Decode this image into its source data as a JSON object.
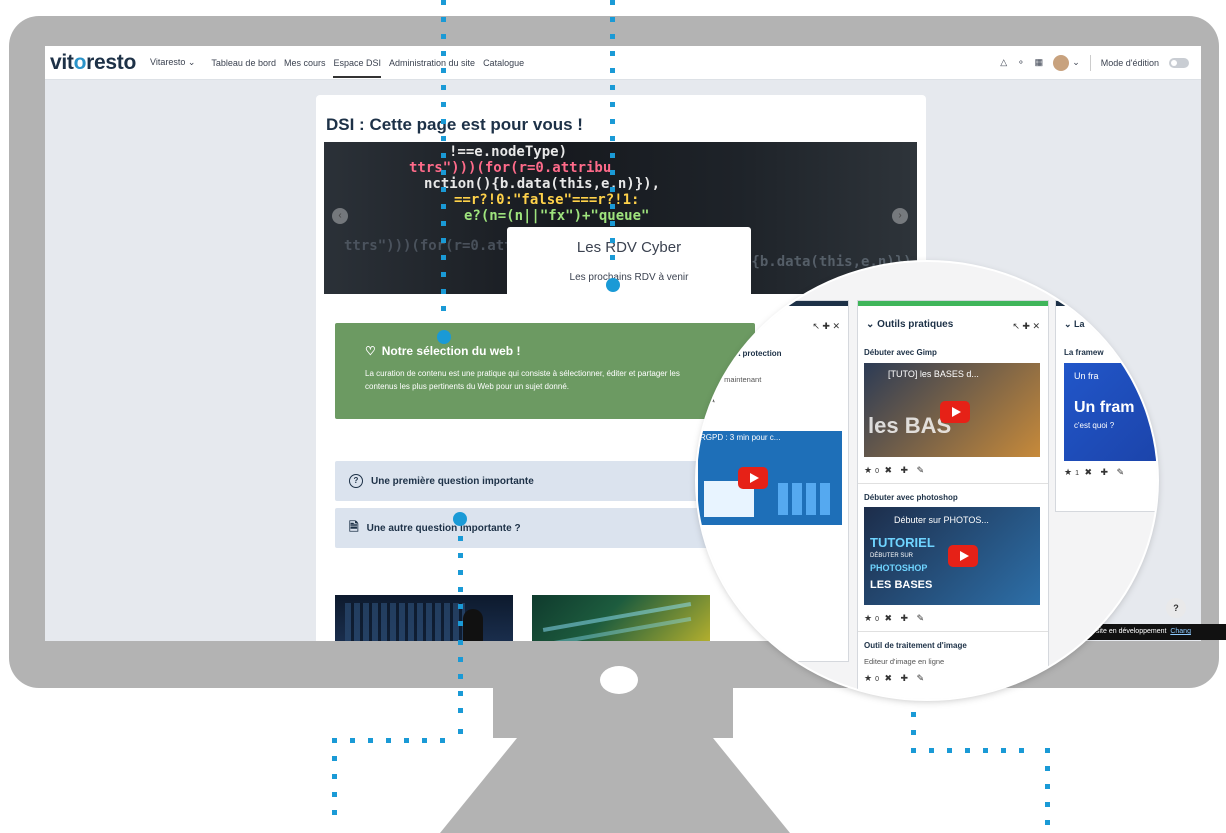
{
  "brand": {
    "logo_pre": "vit",
    "logo_o": "o",
    "logo_post": "resto"
  },
  "nav": {
    "items": [
      "Vitaresto ⌄",
      "Tableau de bord",
      "Mes cours",
      "Espace DSI",
      "Administration du site",
      "Catalogue"
    ],
    "active_index": 3,
    "edit_mode_label": "Mode d'édition"
  },
  "page": {
    "title": "DSI : Cette page est pour vous !"
  },
  "carousel": {
    "title": "Les RDV Cyber",
    "subtitle": "Les prochains RDV à venir",
    "code_lines": [
      "!==e.nodeType)",
      "ttrs\")))(for(r=0.attribu",
      "nction(){b.data(this,e,n)}),",
      "==r?!0:\"false\"===r?!1:",
      "e?(n=(n||\"fx\")+\"queue\""
    ]
  },
  "selection": {
    "title": "Notre sélection du web !",
    "text": "La curation de contenu est une pratique qui consiste à sélectionner, éditer et partager les contenus les plus pertinents du Web pour un sujet donné."
  },
  "faq": [
    "Une première question importante",
    "Une autre question importante ?"
  ],
  "magnifier": {
    "left_col": {
      "label": "al sur la protection",
      "sub": "tion maintenant",
      "video_title": "RGPD : 3 min pour c..."
    },
    "mid_col": {
      "header": "Outils pratiques",
      "items": [
        {
          "label": "Débuter avec Gimp",
          "video_title": "[TUTO] les BASES d...",
          "overlay": "les BAS",
          "count": "0"
        },
        {
          "label": "Débuter avec photoshop",
          "video_title": "Débuter sur PHOTOS...",
          "overlay_1": "TUTORIEL",
          "overlay_2": "DÉBUTER SUR",
          "overlay_3": "PHOTOSHOP",
          "overlay_4": "LES BASES",
          "count": "0"
        },
        {
          "label": "Outil de traitement d'image",
          "sub": "Editeur d'image en ligne",
          "count": "0"
        }
      ]
    },
    "right_col": {
      "header": "La",
      "label": "La framew",
      "video_title": "Un fra",
      "big_1": "Un fram",
      "big_2": "c'est quoi ?",
      "count": "1"
    }
  },
  "footer": {
    "dev_text": "site en développement",
    "dev_link": "Chang"
  },
  "help_label": "?",
  "colors": {
    "accent": "#1a9ad6",
    "green_block": "#6c9a62",
    "navy": "#1d3147",
    "yt_red": "#e62117"
  }
}
